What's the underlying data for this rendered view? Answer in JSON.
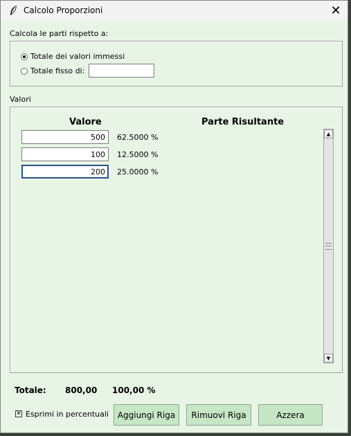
{
  "window": {
    "title": "Calcolo Proporzioni",
    "close_glyph": "✕"
  },
  "calc_group": {
    "label": "Calcola le parti rispetto a:",
    "options": [
      {
        "label": "Totale dei valori immessi",
        "selected": true
      },
      {
        "label": "Totale fisso di:",
        "selected": false
      }
    ],
    "fixed_total_value": ""
  },
  "values_group": {
    "label": "Valori",
    "col_value": "Valore",
    "col_result": "Parte Risultante",
    "rows": [
      {
        "value": "500",
        "result": "62.5000 %"
      },
      {
        "value": "100",
        "result": "12.5000 %"
      },
      {
        "value": "200",
        "result": "25.0000 %"
      }
    ]
  },
  "totals": {
    "label": "Totale:",
    "sum": "800,00",
    "percent": "100,00 %"
  },
  "options": {
    "percent_check_label": "Esprimi in percentuali",
    "percent_checked": true,
    "check_glyph": "✕"
  },
  "buttons": {
    "add_row": "Aggiungi Riga",
    "remove_row": "Rimuovi Riga",
    "reset": "Azzera"
  },
  "icons": {
    "app": "feather-icon",
    "scroll_up": "triangle-up-icon",
    "scroll_down": "triangle-down-icon"
  }
}
